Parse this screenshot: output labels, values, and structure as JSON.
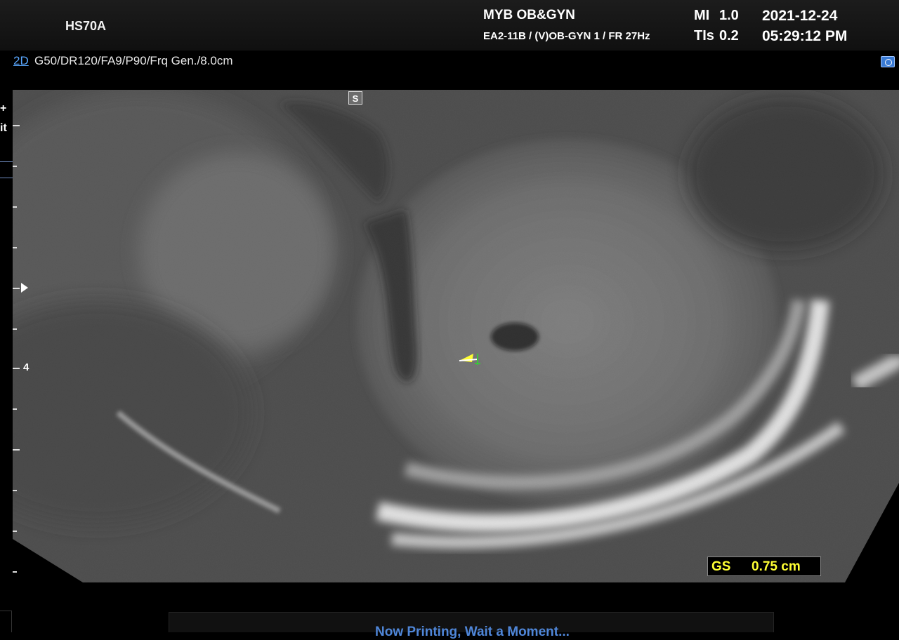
{
  "header": {
    "model": "HS70A",
    "hospital": "MYB OB&GYN",
    "probe_info": "EA2-11B / (V)OB-GYN 1 / FR 27Hz",
    "mi_label": "MI",
    "mi_value": "1.0",
    "tis_label": "TIs",
    "tis_value": "0.2",
    "date": "2021-12-24",
    "time": "05:29:12 PM"
  },
  "params": {
    "mode": "2D",
    "settings": "G50/DR120/FA9/P90/Frq Gen./8.0cm"
  },
  "side": {
    "plus": "+",
    "it": "it"
  },
  "image": {
    "orientation_marker": "S",
    "depth_label": "4"
  },
  "measurement": {
    "label": "GS",
    "value": "0.75 cm",
    "color": "#ffff33"
  },
  "status": {
    "text": "Now Printing, Wait a Moment..."
  },
  "icons": [
    "camera-icon",
    "focus-marker-icon",
    "caliper-icon"
  ]
}
